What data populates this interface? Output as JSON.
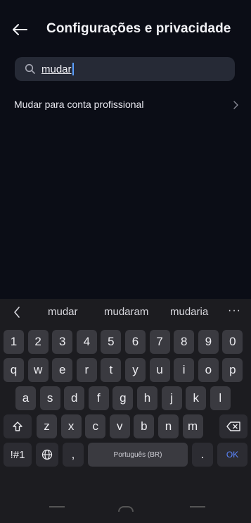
{
  "header": {
    "title": "Configurações e privacidade"
  },
  "search": {
    "value": "mudar",
    "placeholder": ""
  },
  "results": [
    {
      "label": "Mudar para conta profissional"
    }
  ],
  "keyboard": {
    "suggestions": [
      "mudar",
      "mudaram",
      "mudaria"
    ],
    "more": "···",
    "number_row": [
      "1",
      "2",
      "3",
      "4",
      "5",
      "6",
      "7",
      "8",
      "9",
      "0"
    ],
    "row1": [
      "q",
      "w",
      "e",
      "r",
      "t",
      "y",
      "u",
      "i",
      "o",
      "p"
    ],
    "row2": [
      "a",
      "s",
      "d",
      "f",
      "g",
      "h",
      "j",
      "k",
      "l"
    ],
    "row3": [
      "z",
      "x",
      "c",
      "v",
      "b",
      "n",
      "m"
    ],
    "symbols_label": "!#1",
    "comma_label": ",",
    "space_label": "Português (BR)",
    "period_label": ".",
    "ok_label": "OK"
  },
  "colors": {
    "background": "#0b0d16",
    "search_bg": "#262a36",
    "keyboard_bg": "#1c1c20",
    "key_bg": "#3a3a40",
    "accent": "#5b86ff"
  },
  "icons": {
    "back": "arrow-left-icon",
    "search": "search-icon",
    "result_chevron": "chevron-right-icon",
    "shift": "shift-icon",
    "backspace": "backspace-icon",
    "language": "globe-icon"
  }
}
